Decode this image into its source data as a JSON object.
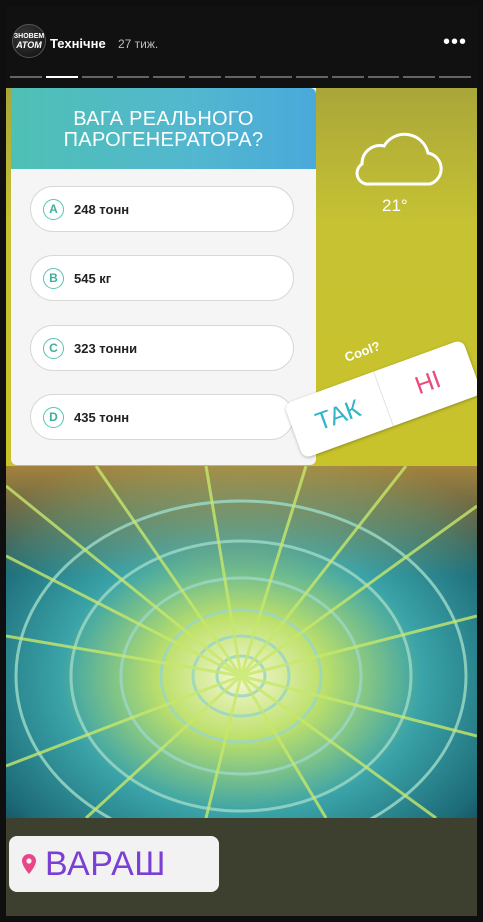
{
  "header": {
    "avatar_line1": "ЗНОВЕМ",
    "avatar_line2": "АТОМ",
    "account": "Технічне",
    "time": "27 тиж.",
    "progress_segments": 13,
    "active_segment": 2
  },
  "quiz": {
    "title_line1": "ВАГА РЕАЛЬНОГО",
    "title_line2": "ПАРОГЕНЕРАТОРА?",
    "options": [
      {
        "letter": "A",
        "text": "248 тонн"
      },
      {
        "letter": "B",
        "text": "545 кг"
      },
      {
        "letter": "C",
        "text": "323 тонни"
      },
      {
        "letter": "D",
        "text": "435 тонн"
      }
    ]
  },
  "weather": {
    "icon": "cloud-icon",
    "temperature": "21°"
  },
  "poll": {
    "question": "Cool?",
    "yes": "ТАК",
    "no": "НІ"
  },
  "location": {
    "icon": "location-pin-icon",
    "name": "ВАРАШ"
  },
  "colors": {
    "accent_teal": "#52b7cf",
    "poll_no": "#e94b7b",
    "location_text": "#7a3fd4"
  }
}
